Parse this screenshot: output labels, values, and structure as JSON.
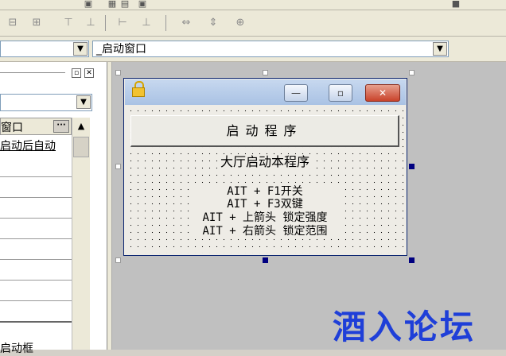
{
  "toolbar": {
    "row2_icons": [
      "align-left-icon",
      "align-center-icon",
      "align-top-icon",
      "align-bottom-icon",
      "equal-width-icon",
      "equal-height-icon",
      "center-horizontal-icon",
      "center-vertical-icon",
      "center-both-icon"
    ]
  },
  "combos": {
    "left_value": "",
    "right_value": "_启动窗口"
  },
  "property_panel": {
    "header_label": "窗口",
    "property_value": "启动后自动",
    "bottom_text": "启动框"
  },
  "form": {
    "start_button_label": "启动程序",
    "title_label": "大厅启动本程序",
    "info_lines": [
      "AIT + F1开关",
      "AIT + F3双键",
      "AIT + 上箭头 锁定强度",
      "AIT + 右箭头 锁定范围"
    ],
    "minimize_glyph": "—",
    "maximize_glyph": "▫",
    "close_glyph": "✕"
  },
  "watermark": "酒入论坛",
  "colors": {
    "selection_handle": "#000080",
    "watermark": "#1f3fd8",
    "close_button": "#c9432b"
  }
}
